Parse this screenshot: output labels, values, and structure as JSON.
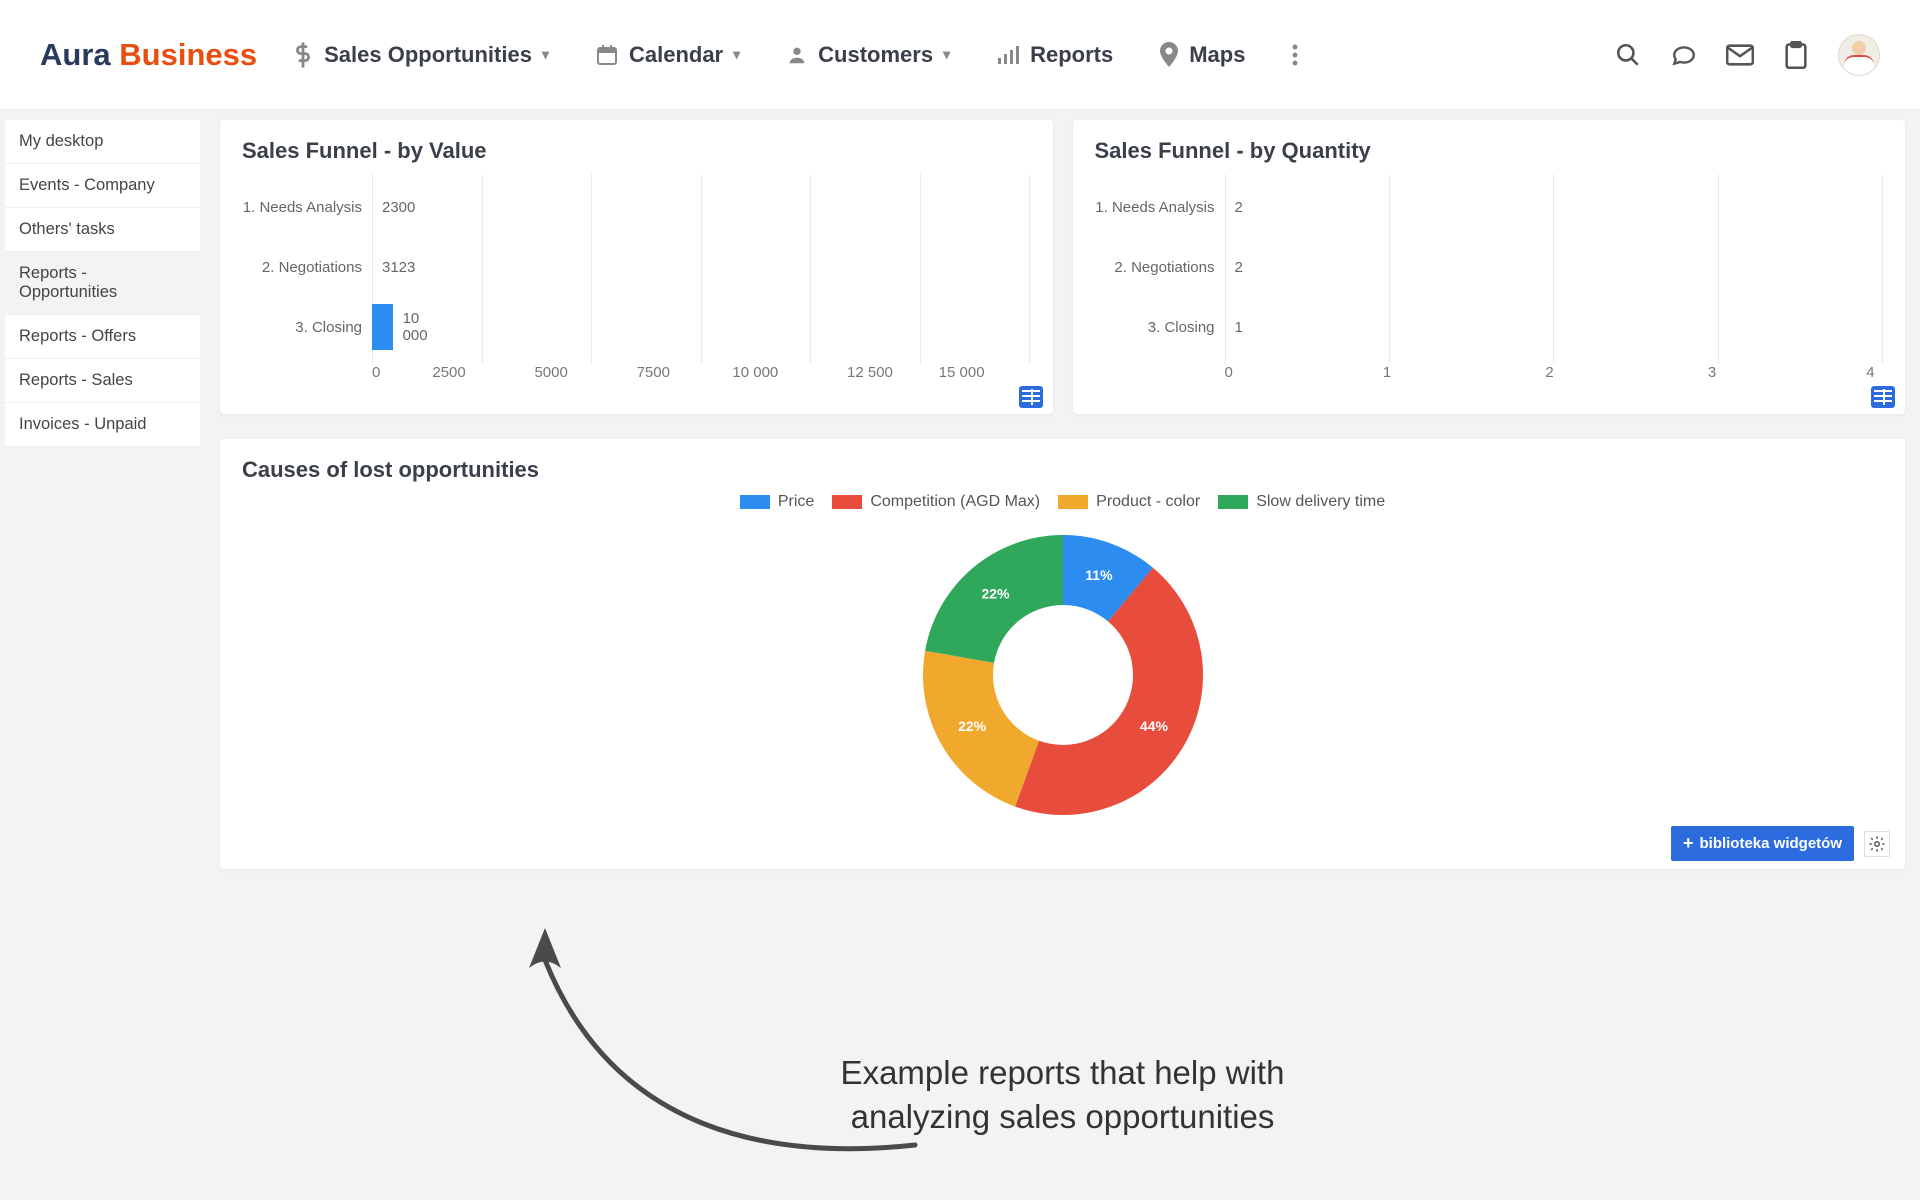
{
  "logo": {
    "part1": "Aura",
    "part2": "Business"
  },
  "nav": {
    "sales_opportunities": "Sales Opportunities",
    "calendar": "Calendar",
    "customers": "Customers",
    "reports": "Reports",
    "maps": "Maps"
  },
  "sidebar": {
    "items": [
      {
        "label": "My desktop"
      },
      {
        "label": "Events - Company"
      },
      {
        "label": "Others' tasks"
      },
      {
        "label": "Reports - Opportunities"
      },
      {
        "label": "Reports - Offers"
      },
      {
        "label": "Reports - Sales"
      },
      {
        "label": "Invoices - Unpaid"
      }
    ],
    "active_index": 3
  },
  "cards": {
    "funnel_value": {
      "title": "Sales Funnel - by Value"
    },
    "funnel_qty": {
      "title": "Sales Funnel - by Quantity"
    },
    "lost_causes": {
      "title": "Causes of lost opportunities"
    }
  },
  "widget_button": "biblioteka widgetów",
  "annotation": "Example reports that help with\nanalyzing sales opportunities",
  "colors": {
    "blue": "#2d8cf0",
    "red": "#e74c3c",
    "orange": "#f0a82d",
    "green": "#2fa85c"
  },
  "chart_data": [
    {
      "id": "funnel_value",
      "type": "bar",
      "orientation": "horizontal",
      "title": "Sales Funnel - by Value",
      "categories": [
        "1. Needs Analysis",
        "2. Negotiations",
        "3. Closing"
      ],
      "values": [
        2300,
        3123,
        10000
      ],
      "value_labels": [
        "2300",
        "3123",
        "10 000"
      ],
      "xlim": [
        0,
        15000
      ],
      "x_ticks": [
        "0",
        "2500",
        "5000",
        "7500",
        "10 000",
        "12 500",
        "15 000"
      ],
      "color": "#2d8cf0"
    },
    {
      "id": "funnel_qty",
      "type": "bar",
      "orientation": "horizontal",
      "title": "Sales Funnel - by Quantity",
      "categories": [
        "1. Needs Analysis",
        "2. Negotiations",
        "3. Closing"
      ],
      "values": [
        2,
        2,
        1
      ],
      "value_labels": [
        "2",
        "2",
        "1"
      ],
      "xlim": [
        0,
        4
      ],
      "x_ticks": [
        "0",
        "1",
        "2",
        "3",
        "4"
      ],
      "color": "#2d8cf0"
    },
    {
      "id": "lost_causes",
      "type": "pie",
      "subtype": "donut",
      "title": "Causes of lost opportunities",
      "series": [
        {
          "name": "Price",
          "value": 11,
          "label": "11%",
          "color": "#2d8cf0"
        },
        {
          "name": "Competition (AGD Max)",
          "value": 44,
          "label": "44%",
          "color": "#e74c3c"
        },
        {
          "name": "Product - color",
          "value": 22,
          "label": "22%",
          "color": "#f0a82d"
        },
        {
          "name": "Slow delivery time",
          "value": 22,
          "label": "22%",
          "color": "#2fa85c"
        }
      ]
    }
  ]
}
